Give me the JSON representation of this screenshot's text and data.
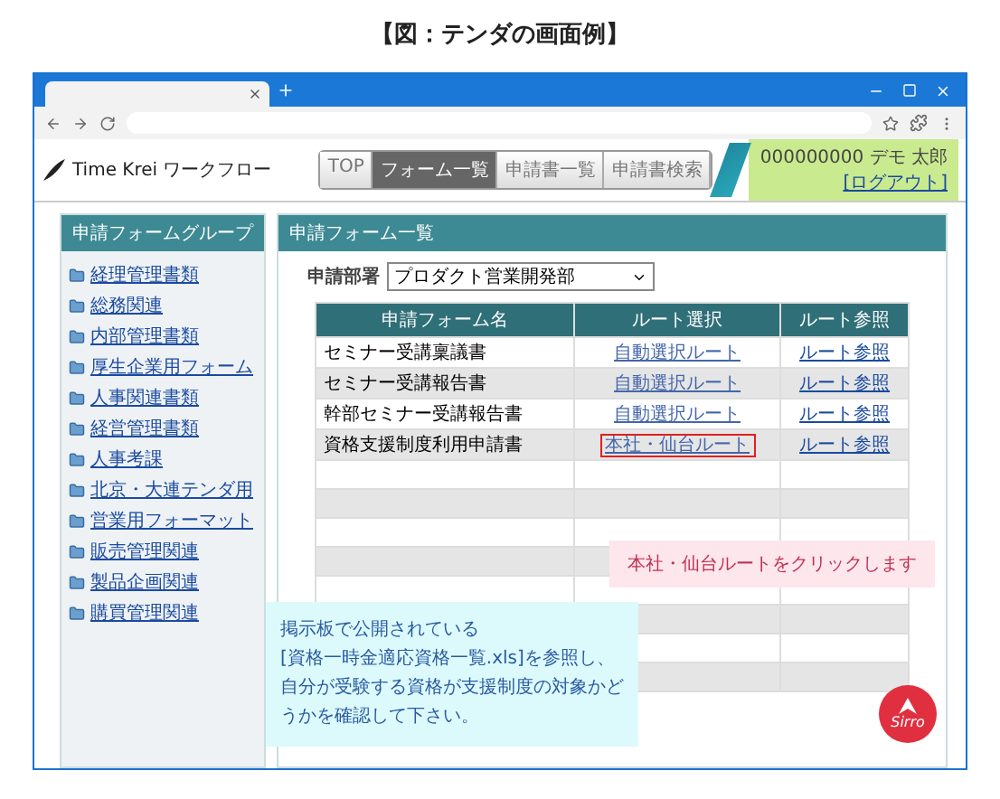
{
  "caption": "【図：テンダの画面例】",
  "app": {
    "logo": "Time Krei ワークフロー",
    "nav_tabs": [
      {
        "label": "TOP",
        "selected": false
      },
      {
        "label": "フォーム一覧",
        "selected": true
      },
      {
        "label": "申請書一覧",
        "selected": false
      },
      {
        "label": "申請書検索",
        "selected": false
      }
    ],
    "user": {
      "name": "000000000 デモ 太郎",
      "logout": "[ログアウト]"
    }
  },
  "sidebar": {
    "title": "申請フォームグループ",
    "items": [
      "経理管理書類",
      "総務関連",
      "内部管理書類",
      "厚生企業用フォーム",
      "人事関連書類",
      "経営管理書類",
      "人事考課",
      "北京・大連テンダ用",
      "営業用フォーマット",
      "販売管理関連",
      "製品企画関連",
      "購買管理関連"
    ]
  },
  "main": {
    "title": "申請フォーム一覧",
    "department": {
      "label": "申請部署",
      "value": "プロダクト営業開発部"
    },
    "table": {
      "columns": [
        "申請フォーム名",
        "ルート選択",
        "ルート参照"
      ],
      "rows": [
        {
          "name": "セミナー受講稟議書",
          "route": "自動選択ルート",
          "ref": "ルート参照",
          "highlighted": false
        },
        {
          "name": "セミナー受講報告書",
          "route": "自動選択ルート",
          "ref": "ルート参照",
          "highlighted": false
        },
        {
          "name": "幹部セミナー受講報告書",
          "route": "自動選択ルート",
          "ref": "ルート参照",
          "highlighted": false
        },
        {
          "name": "資格支援制度利用申請書",
          "route": "本社・仙台ルート",
          "ref": "ルート参照",
          "highlighted": true
        }
      ]
    }
  },
  "tooltip": "本社・仙台ルートをクリックします",
  "note": [
    "掲示板で公開されている",
    "[資格一時金適応資格一覧.xls]を参照し、",
    "自分が受験する資格が支援制度の対象かど",
    "うかを確認して下さい。"
  ],
  "badge": "Sirro"
}
